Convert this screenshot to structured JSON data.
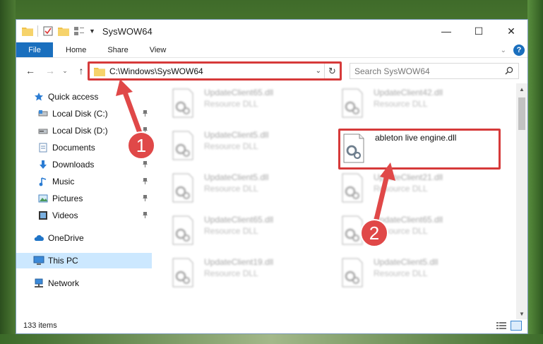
{
  "window": {
    "title": "SysWOW64",
    "controls": {
      "minimize": "—",
      "maximize": "☐",
      "close": "✕"
    }
  },
  "ribbon": {
    "tabs": [
      "File",
      "Home",
      "Share",
      "View"
    ],
    "help": "?"
  },
  "nav": {
    "address": "C:\\Windows\\SysWOW64",
    "search_placeholder": "Search SysWOW64"
  },
  "sidebar": {
    "items": [
      {
        "label": "Quick access",
        "icon": "star-icon"
      },
      {
        "label": "Local Disk (C:)",
        "icon": "drive-icon"
      },
      {
        "label": "Local Disk (D:)",
        "icon": "drive-icon"
      },
      {
        "label": "Documents",
        "icon": "documents-icon"
      },
      {
        "label": "Downloads",
        "icon": "download-icon"
      },
      {
        "label": "Music",
        "icon": "music-icon"
      },
      {
        "label": "Pictures",
        "icon": "pictures-icon"
      },
      {
        "label": "Videos",
        "icon": "videos-icon"
      },
      {
        "label": "OneDrive",
        "icon": "cloud-icon"
      },
      {
        "label": "This PC",
        "icon": "computer-icon"
      },
      {
        "label": "Network",
        "icon": "network-icon"
      }
    ]
  },
  "files": [
    {
      "name": "UpdateClient65.dll",
      "type": "Resource DLL"
    },
    {
      "name": "UpdateClient42.dll",
      "type": "Resource DLL"
    },
    {
      "name": "UpdateClient5.dll",
      "type": "Resource DLL"
    },
    {
      "name": "ableton live engine.dll",
      "type": ""
    },
    {
      "name": "UpdateClient5.dll",
      "type": "Resource DLL"
    },
    {
      "name": "UpdateClient21.dll",
      "type": "Resource DLL"
    },
    {
      "name": "UpdateClient65.dll",
      "type": "Resource DLL"
    },
    {
      "name": "UpdateClient65.dll",
      "type": "Resource DLL"
    },
    {
      "name": "UpdateClient19.dll",
      "type": "Resource DLL"
    },
    {
      "name": "UpdateClient5.dll",
      "type": "Resource DLL"
    }
  ],
  "status": {
    "item_count": "133 items"
  },
  "annotations": {
    "step1": "1",
    "step2": "2"
  },
  "colors": {
    "accent": "#1a6fbe",
    "highlight": "#d63a3a",
    "selected": "#cce8ff"
  }
}
